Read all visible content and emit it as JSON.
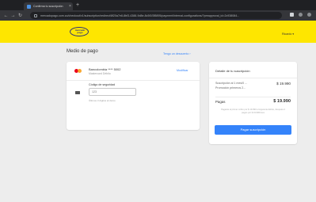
{
  "browser": {
    "tab_title": "Confirma tu suscripción",
    "tab_close": "×",
    "new_tab": "+",
    "url": "mercadopago.com.co/checkout/v1/subscription/redirect/8f20a7e8-8bf3-4388-9d8e-8c5f1f3f5895/payment/internal-configurations/?preapproval_id=2c938084...",
    "nav": {
      "back": "←",
      "forward": "→",
      "reload": "↻"
    }
  },
  "header": {
    "logo_text": "mercado pago",
    "user_link": "Ricardo ▾"
  },
  "payment": {
    "title": "Medio de pago",
    "change_method_link": "Tengo un descuento ›",
    "card": {
      "name": "Bancolombia **** 5002",
      "type": "Mastercard Débito",
      "modify_link": "Modificar"
    },
    "cvv": {
      "label": "Código de seguridad",
      "placeholder": "123",
      "help": "Últimos 3 dígitos al dorso"
    }
  },
  "summary": {
    "title": "Detalle de tu suscripción",
    "rows": [
      {
        "label": "Suscripción al 1 mes/0 ...",
        "value": "$ 19.990"
      },
      {
        "label": "Promoción primeros 2...",
        "value": ""
      }
    ],
    "pay_label": "Pagas",
    "pay_value": "$ 19.990",
    "legal_text": "Pagarás el primer cobro por $ 19.990 el siguiente débito, después 2 pagos por $ 19.990/mes",
    "pay_button": "Pagar suscripción"
  },
  "colors": {
    "header_yellow": "#fee600",
    "primary_blue": "#3483fa"
  }
}
